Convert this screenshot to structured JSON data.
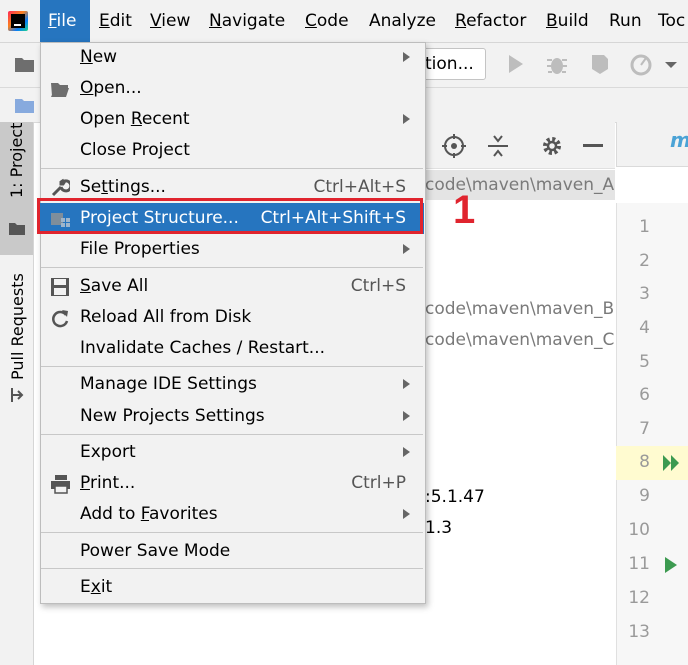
{
  "menubar": {
    "items": [
      {
        "label": "File",
        "mnemonic": "F",
        "rest": "ile"
      },
      {
        "label": "Edit",
        "mnemonic": "E",
        "rest": "dit"
      },
      {
        "label": "View",
        "mnemonic": "V",
        "rest": "iew"
      },
      {
        "label": "Navigate",
        "mnemonic": "N",
        "rest": "avigate"
      },
      {
        "label": "Code",
        "mnemonic": "C",
        "rest": "ode"
      },
      {
        "label": "Analyze",
        "mnemonic": "",
        "rest": "Analyze"
      },
      {
        "label": "Refactor",
        "mnemonic": "R",
        "rest": "efactor"
      },
      {
        "label": "Build",
        "mnemonic": "B",
        "rest": "uild"
      },
      {
        "label": "Run",
        "mnemonic": "",
        "rest": "Run"
      },
      {
        "label": "Tools",
        "mnemonic": "",
        "rest": "Toc"
      }
    ]
  },
  "toolbar": {
    "run_config_text": "tion..."
  },
  "left_stripe": {
    "project_tab": "1: Project",
    "pull_requests_tab": "Pull Requests"
  },
  "project_panel": {
    "paths": [
      "code\\maven\\maven_A",
      "code\\maven\\maven_B",
      "code\\maven\\maven_C"
    ],
    "dependency_versions": [
      ":5.1.47",
      "1.3"
    ]
  },
  "editor": {
    "tab_label": "m",
    "line_numbers": [
      "1",
      "2",
      "3",
      "4",
      "5",
      "6",
      "7",
      "8",
      "9",
      "10",
      "11",
      "12",
      "13"
    ]
  },
  "file_menu": {
    "items": [
      {
        "pre": "",
        "u": "N",
        "post": "ew",
        "shortcut": "",
        "submenu": true,
        "icon": ""
      },
      {
        "pre": "",
        "u": "O",
        "post": "pen...",
        "shortcut": "",
        "submenu": false,
        "icon": "folder-open-icon"
      },
      {
        "pre": "Open ",
        "u": "R",
        "post": "ecent",
        "shortcut": "",
        "submenu": true,
        "icon": ""
      },
      {
        "pre": "Close Project",
        "u": "",
        "post": "",
        "shortcut": "",
        "submenu": false,
        "icon": ""
      },
      {
        "pre": "Se",
        "u": "t",
        "post": "tings...",
        "shortcut": "Ctrl+Alt+S",
        "submenu": false,
        "icon": "wrench-icon"
      },
      {
        "pre": "Project Structure...",
        "u": "",
        "post": "",
        "shortcut": "Ctrl+Alt+Shift+S",
        "submenu": false,
        "icon": "project-structure-icon"
      },
      {
        "pre": "File Properties",
        "u": "",
        "post": "",
        "shortcut": "",
        "submenu": true,
        "icon": ""
      },
      {
        "pre": "",
        "u": "S",
        "post": "ave All",
        "shortcut": "Ctrl+S",
        "submenu": false,
        "icon": "save-icon"
      },
      {
        "pre": "Reload All from Disk",
        "u": "",
        "post": "",
        "shortcut": "",
        "submenu": false,
        "icon": "reload-icon"
      },
      {
        "pre": "Invalidate Caches / Restart...",
        "u": "",
        "post": "",
        "shortcut": "",
        "submenu": false,
        "icon": ""
      },
      {
        "pre": "Manage IDE Settings",
        "u": "",
        "post": "",
        "shortcut": "",
        "submenu": true,
        "icon": ""
      },
      {
        "pre": "New Projects Settings",
        "u": "",
        "post": "",
        "shortcut": "",
        "submenu": true,
        "icon": ""
      },
      {
        "pre": "Export",
        "u": "",
        "post": "",
        "shortcut": "",
        "submenu": true,
        "icon": ""
      },
      {
        "pre": "",
        "u": "P",
        "post": "rint...",
        "shortcut": "Ctrl+P",
        "submenu": false,
        "icon": "print-icon"
      },
      {
        "pre": "Add to ",
        "u": "F",
        "post": "avorites",
        "shortcut": "",
        "submenu": true,
        "icon": ""
      },
      {
        "pre": "Power Save Mode",
        "u": "",
        "post": "",
        "shortcut": "",
        "submenu": false,
        "icon": ""
      },
      {
        "pre": "E",
        "u": "x",
        "post": "it",
        "shortcut": "",
        "submenu": false,
        "icon": ""
      }
    ]
  },
  "annotation": {
    "step_number": "1",
    "color": "#e0242e"
  },
  "colors": {
    "selection": "#2675bf",
    "menu_bg": "#f2f2f2"
  }
}
